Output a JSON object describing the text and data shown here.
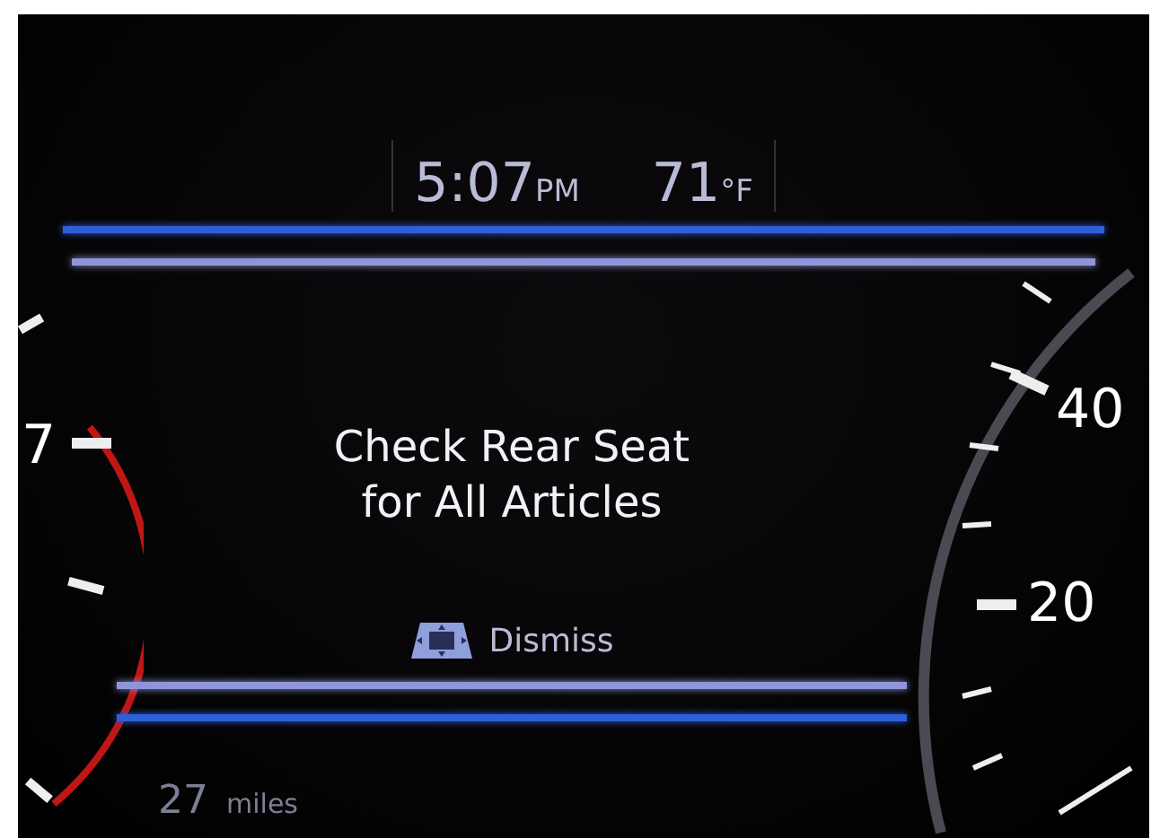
{
  "clock": {
    "time": "5:07",
    "period": "PM"
  },
  "temperature": {
    "value": "71",
    "unit": "°F"
  },
  "message": {
    "lines": [
      "Check Rear Seat",
      "for All Articles"
    ]
  },
  "dismiss": {
    "label": "Dismiss"
  },
  "range": {
    "value": "27",
    "unit": "miles"
  },
  "left_gauge": {
    "labels": [
      "7"
    ]
  },
  "right_gauge": {
    "labels": [
      "40",
      "20"
    ]
  }
}
